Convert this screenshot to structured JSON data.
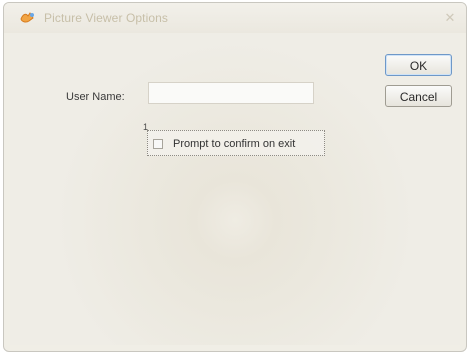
{
  "window": {
    "title": "Picture Viewer Options"
  },
  "buttons": {
    "ok_label": "OK",
    "cancel_label": "Cancel"
  },
  "form": {
    "user_name_label": "User Name:",
    "user_name_value": "",
    "tab_marker": "1",
    "prompt_confirm_label": "Prompt to confirm on exit",
    "prompt_confirm_checked": false
  },
  "icons": {
    "app_icon": "app-icon",
    "close_icon": "close-icon"
  },
  "colors": {
    "window_bg": "#f0eee6",
    "title_text": "#c7bfa8",
    "ok_border": "#6e98c8"
  }
}
